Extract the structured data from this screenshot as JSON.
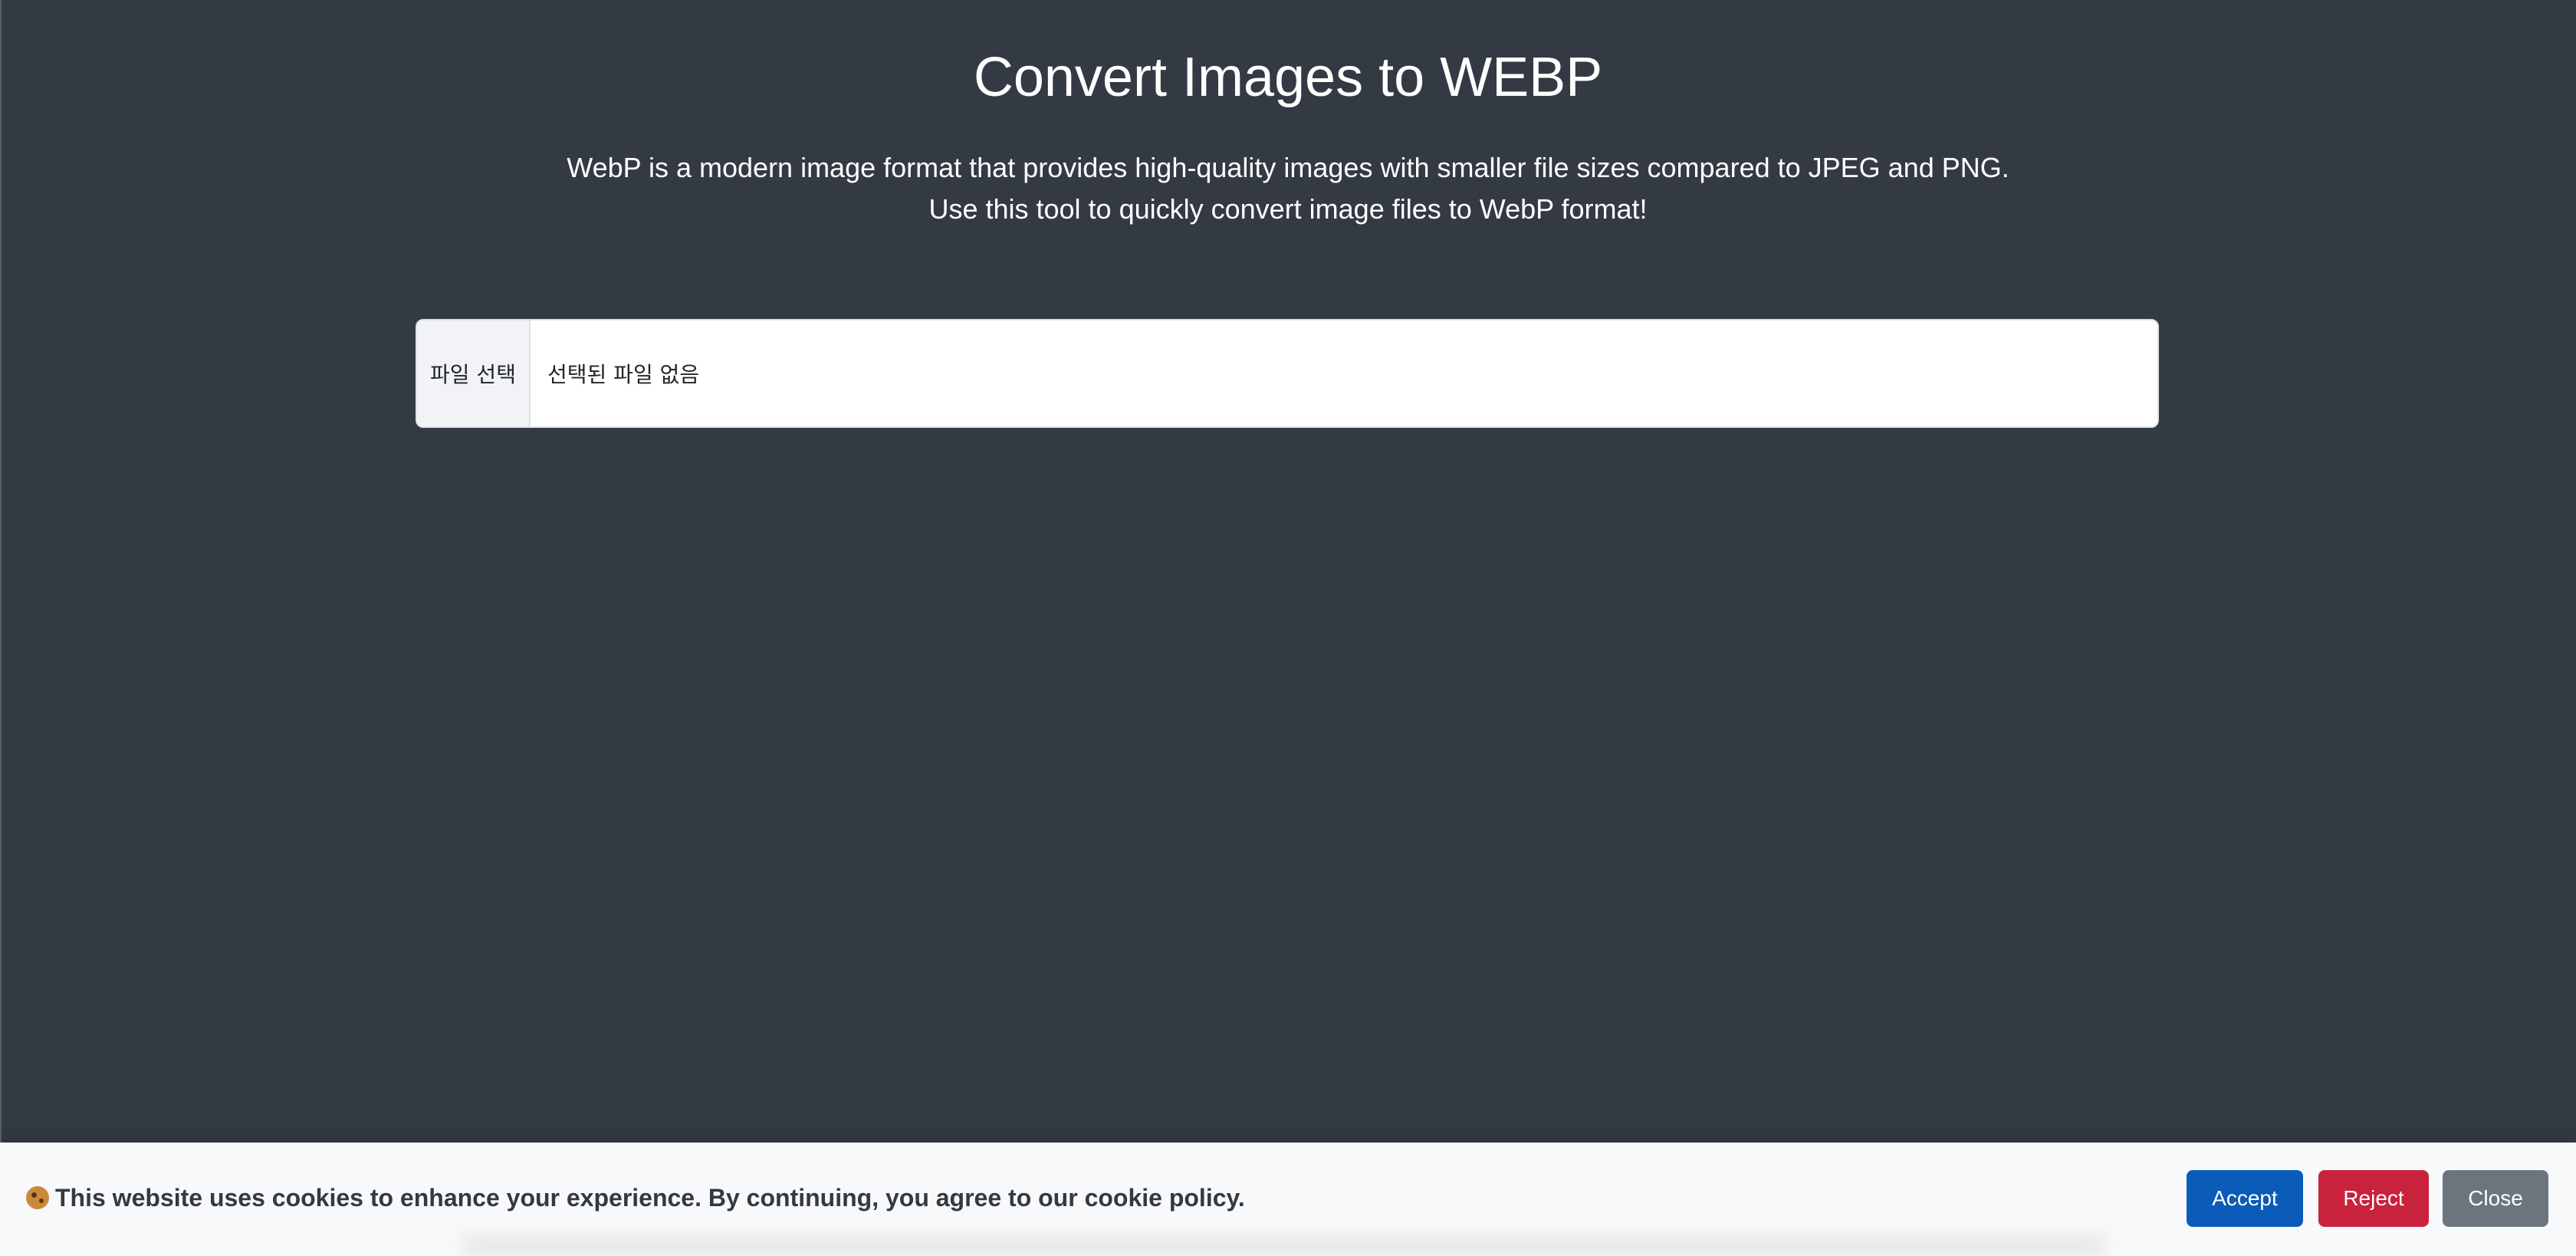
{
  "header": {
    "title": "Convert Images to WEBP",
    "description_line1": "WebP is a modern image format that provides high-quality images with smaller file sizes compared to JPEG and PNG.",
    "description_line2": "Use this tool to quickly convert image files to WebP format!"
  },
  "file_input": {
    "button_label": "파일 선택",
    "status_text": "선택된 파일 없음"
  },
  "cookie_banner": {
    "icon": "cookie-icon",
    "message": "This website uses cookies to enhance your experience. By continuing, you agree to our cookie policy.",
    "accept_label": "Accept",
    "reject_label": "Reject",
    "close_label": "Close"
  },
  "colors": {
    "background": "#343a43",
    "accept": "#0b5cb8",
    "reject": "#c8223d",
    "close": "#6c757d"
  }
}
